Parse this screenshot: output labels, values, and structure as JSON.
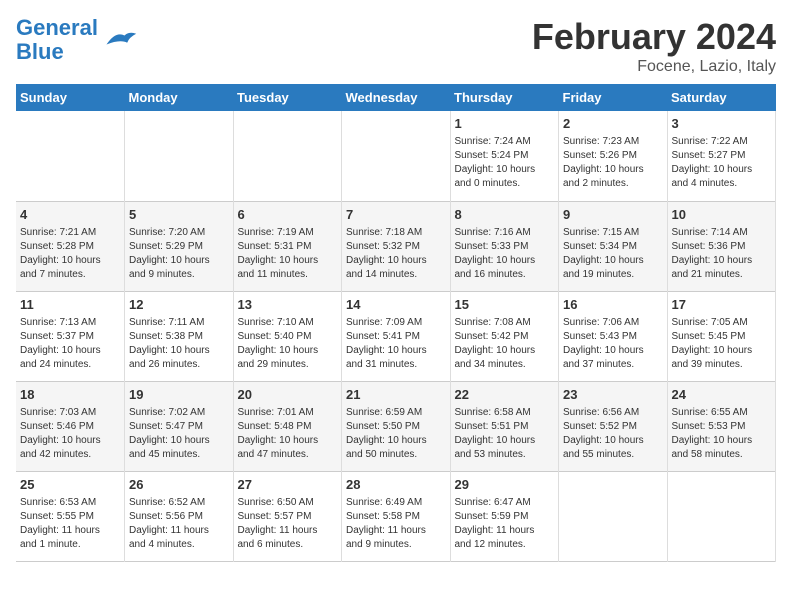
{
  "header": {
    "logo_line1": "General",
    "logo_line2": "Blue",
    "main_title": "February 2024",
    "sub_title": "Focene, Lazio, Italy"
  },
  "days_of_week": [
    "Sunday",
    "Monday",
    "Tuesday",
    "Wednesday",
    "Thursday",
    "Friday",
    "Saturday"
  ],
  "weeks": [
    [
      {
        "day": "",
        "info": ""
      },
      {
        "day": "",
        "info": ""
      },
      {
        "day": "",
        "info": ""
      },
      {
        "day": "",
        "info": ""
      },
      {
        "day": "1",
        "info": "Sunrise: 7:24 AM\nSunset: 5:24 PM\nDaylight: 10 hours\nand 0 minutes."
      },
      {
        "day": "2",
        "info": "Sunrise: 7:23 AM\nSunset: 5:26 PM\nDaylight: 10 hours\nand 2 minutes."
      },
      {
        "day": "3",
        "info": "Sunrise: 7:22 AM\nSunset: 5:27 PM\nDaylight: 10 hours\nand 4 minutes."
      }
    ],
    [
      {
        "day": "4",
        "info": "Sunrise: 7:21 AM\nSunset: 5:28 PM\nDaylight: 10 hours\nand 7 minutes."
      },
      {
        "day": "5",
        "info": "Sunrise: 7:20 AM\nSunset: 5:29 PM\nDaylight: 10 hours\nand 9 minutes."
      },
      {
        "day": "6",
        "info": "Sunrise: 7:19 AM\nSunset: 5:31 PM\nDaylight: 10 hours\nand 11 minutes."
      },
      {
        "day": "7",
        "info": "Sunrise: 7:18 AM\nSunset: 5:32 PM\nDaylight: 10 hours\nand 14 minutes."
      },
      {
        "day": "8",
        "info": "Sunrise: 7:16 AM\nSunset: 5:33 PM\nDaylight: 10 hours\nand 16 minutes."
      },
      {
        "day": "9",
        "info": "Sunrise: 7:15 AM\nSunset: 5:34 PM\nDaylight: 10 hours\nand 19 minutes."
      },
      {
        "day": "10",
        "info": "Sunrise: 7:14 AM\nSunset: 5:36 PM\nDaylight: 10 hours\nand 21 minutes."
      }
    ],
    [
      {
        "day": "11",
        "info": "Sunrise: 7:13 AM\nSunset: 5:37 PM\nDaylight: 10 hours\nand 24 minutes."
      },
      {
        "day": "12",
        "info": "Sunrise: 7:11 AM\nSunset: 5:38 PM\nDaylight: 10 hours\nand 26 minutes."
      },
      {
        "day": "13",
        "info": "Sunrise: 7:10 AM\nSunset: 5:40 PM\nDaylight: 10 hours\nand 29 minutes."
      },
      {
        "day": "14",
        "info": "Sunrise: 7:09 AM\nSunset: 5:41 PM\nDaylight: 10 hours\nand 31 minutes."
      },
      {
        "day": "15",
        "info": "Sunrise: 7:08 AM\nSunset: 5:42 PM\nDaylight: 10 hours\nand 34 minutes."
      },
      {
        "day": "16",
        "info": "Sunrise: 7:06 AM\nSunset: 5:43 PM\nDaylight: 10 hours\nand 37 minutes."
      },
      {
        "day": "17",
        "info": "Sunrise: 7:05 AM\nSunset: 5:45 PM\nDaylight: 10 hours\nand 39 minutes."
      }
    ],
    [
      {
        "day": "18",
        "info": "Sunrise: 7:03 AM\nSunset: 5:46 PM\nDaylight: 10 hours\nand 42 minutes."
      },
      {
        "day": "19",
        "info": "Sunrise: 7:02 AM\nSunset: 5:47 PM\nDaylight: 10 hours\nand 45 minutes."
      },
      {
        "day": "20",
        "info": "Sunrise: 7:01 AM\nSunset: 5:48 PM\nDaylight: 10 hours\nand 47 minutes."
      },
      {
        "day": "21",
        "info": "Sunrise: 6:59 AM\nSunset: 5:50 PM\nDaylight: 10 hours\nand 50 minutes."
      },
      {
        "day": "22",
        "info": "Sunrise: 6:58 AM\nSunset: 5:51 PM\nDaylight: 10 hours\nand 53 minutes."
      },
      {
        "day": "23",
        "info": "Sunrise: 6:56 AM\nSunset: 5:52 PM\nDaylight: 10 hours\nand 55 minutes."
      },
      {
        "day": "24",
        "info": "Sunrise: 6:55 AM\nSunset: 5:53 PM\nDaylight: 10 hours\nand 58 minutes."
      }
    ],
    [
      {
        "day": "25",
        "info": "Sunrise: 6:53 AM\nSunset: 5:55 PM\nDaylight: 11 hours\nand 1 minute."
      },
      {
        "day": "26",
        "info": "Sunrise: 6:52 AM\nSunset: 5:56 PM\nDaylight: 11 hours\nand 4 minutes."
      },
      {
        "day": "27",
        "info": "Sunrise: 6:50 AM\nSunset: 5:57 PM\nDaylight: 11 hours\nand 6 minutes."
      },
      {
        "day": "28",
        "info": "Sunrise: 6:49 AM\nSunset: 5:58 PM\nDaylight: 11 hours\nand 9 minutes."
      },
      {
        "day": "29",
        "info": "Sunrise: 6:47 AM\nSunset: 5:59 PM\nDaylight: 11 hours\nand 12 minutes."
      },
      {
        "day": "",
        "info": ""
      },
      {
        "day": "",
        "info": ""
      }
    ]
  ]
}
